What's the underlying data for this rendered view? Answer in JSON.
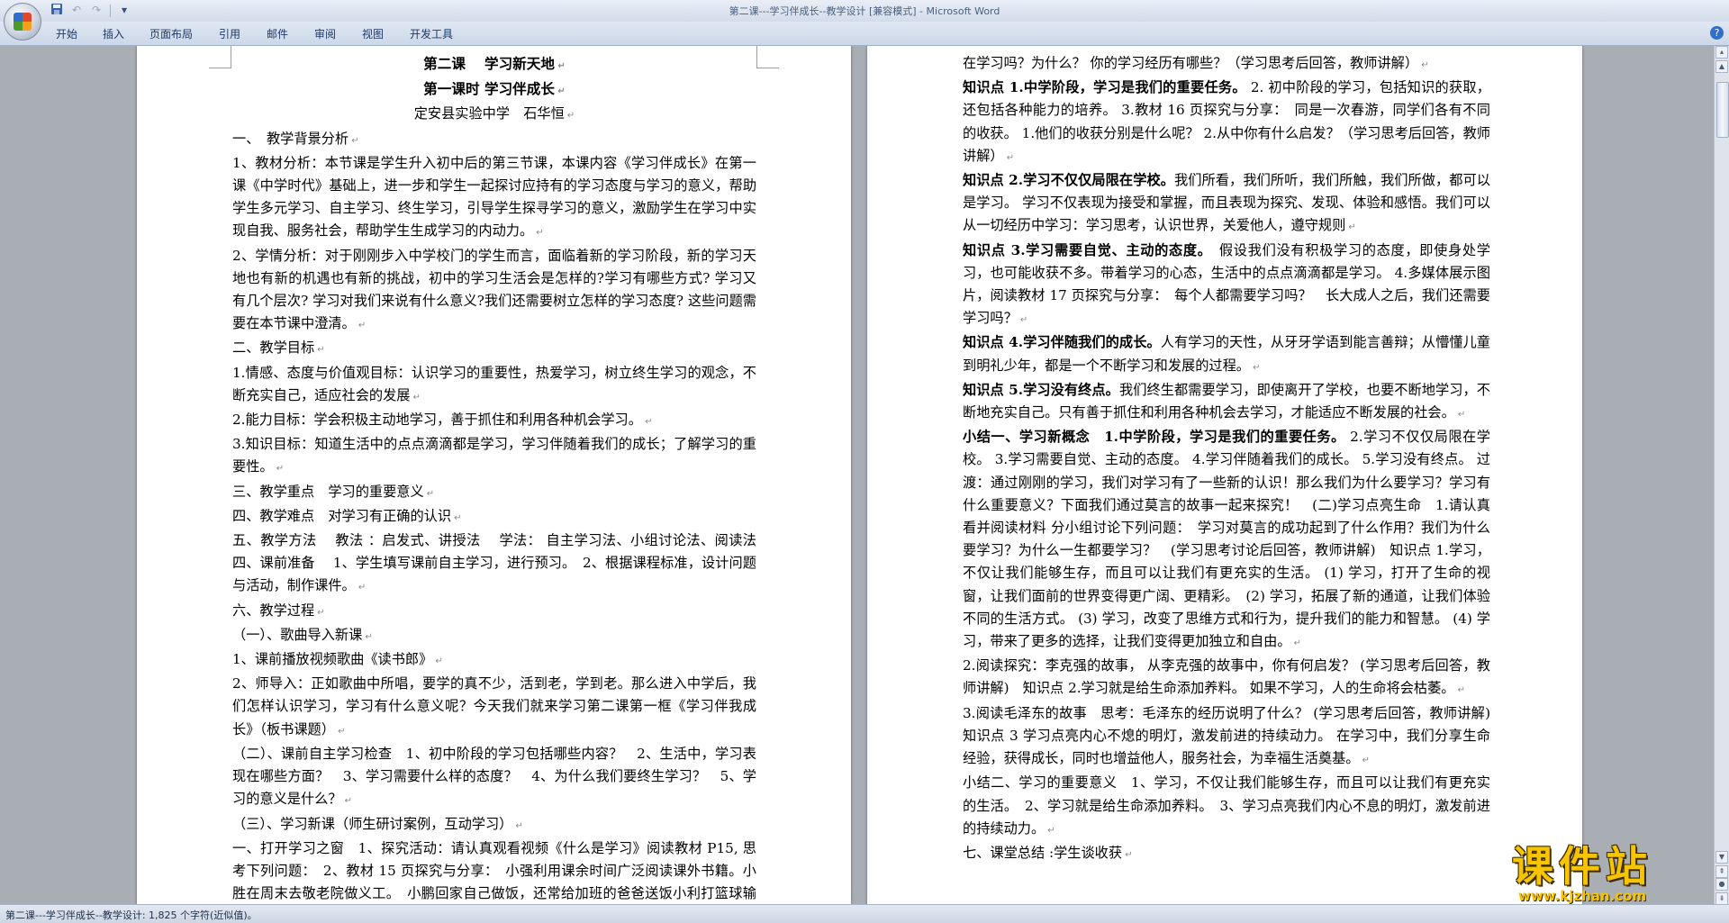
{
  "window": {
    "title": "第二课---学习伴成长--教学设计 [兼容模式] - Microsoft Word"
  },
  "quick_access": {
    "save_icon": "floppy-disk-icon",
    "undo_icon": "undo-icon",
    "redo_icon": "redo-icon",
    "customize_icon": "chevron-down-icon"
  },
  "ribbon": {
    "tabs": [
      "开始",
      "插入",
      "页面布局",
      "引用",
      "邮件",
      "审阅",
      "视图",
      "开发工具"
    ],
    "help_label": "?"
  },
  "page_left": {
    "lines": [
      {
        "text": "第二课　 学习新天地",
        "style": "title"
      },
      {
        "text": "第一课时  学习伴成长",
        "style": "title"
      },
      {
        "text": "定安县实验中学　石华恒",
        "style": "center"
      },
      {
        "text": "一、　教学背景分析",
        "style": ""
      },
      {
        "text": "1、教材分析：本节课是学生升入初中后的第三节课，本课内容《学习伴成长》在第一课《中学时代》基础上，进一步和学生一起探讨应持有的学习态度与学习的意义，帮助学生多元学习、自主学习、终生学习，引导学生探寻学习的意义，激励学生在学习中实现自我、服务社会，帮助学生生成学习的内动力。",
        "style": ""
      },
      {
        "text": "2、学情分析：对于刚刚步入中学校门的学生而言，面临着新的学习阶段，新的学习天地也有新的机遇也有新的挑战，初中的学习生活会是怎样的?学习有哪些方式? 学习又有几个层次? 学习对我们来说有什么意义?我们还需要树立怎样的学习态度? 这些问题需要在本节课中澄清。",
        "style": ""
      },
      {
        "text": "二、教学目标",
        "style": ""
      },
      {
        "text": "1.情感、态度与价值观目标：认识学习的重要性，热爱学习，树立终生学习的观念，不断充实自己，适应社会的发展",
        "style": ""
      },
      {
        "text": "2.能力目标：学会积极主动地学习，善于抓住和利用各种机会学习。",
        "style": ""
      },
      {
        "text": "3.知识目标：知道生活中的点点滴滴都是学习，学习伴随着我们的成长；了解学习的重要性。",
        "style": ""
      },
      {
        "text": "三、教学重点　学习的重要意义",
        "style": ""
      },
      {
        "text": "四、教学难点　对学习有正确的认识",
        "style": ""
      },
      {
        "text": "五、教学方法　 教法 ：启发式、讲授法　 学法： 自主学习法、小组讨论法、阅读法四、课前准备　 1、学生填写课前自主学习，进行预习。　2、根据课程标准，设计问题与活动，制作课件。",
        "style": ""
      },
      {
        "text": "六、教学过程",
        "style": ""
      },
      {
        "text": "（一）、歌曲导入新课",
        "style": ""
      },
      {
        "text": "1、课前播放视频歌曲《读书郎》",
        "style": ""
      },
      {
        "text": "2、师导入：正如歌曲中所唱，要学的真不少，活到老，学到老。那么进入中学后，我们怎样认识学习，学习有什么意义呢？今天我们就来学习第二课第一框《学习伴我成长》（板书课题）",
        "style": ""
      },
      {
        "text": "（二）、课前自主学习检查　1、初中阶段的学习包括哪些内容？　2、生活中，学习表现在哪些方面？　3、学习需要什么样的态度？　4、为什么我们要终生学习？　5、学习的意义是什么？",
        "style": ""
      },
      {
        "text": "（三）、学习新课（师生研讨案例，互动学习）",
        "style": ""
      },
      {
        "text": "一、打开学习之窗　1、探究活动：请认真观看视频《什么是学习》阅读教材 P15, 思考下列问题：　2、教材 15 页探究与分享：　小强利用课余时间广泛阅读课外书籍。小胜在周末去敬老院做义工。　小鹏回家自己做饭，还常给加班的爸爸送饭小利打篮球输了，被同伴喝倒彩，他装作什么都没有发生一样喝同伴一起聊天。。　他们是",
        "style": "lead"
      }
    ]
  },
  "page_right": {
    "lines": [
      {
        "text": "在学习吗？为什么？  你的学习经历有哪些？（学习思考后回答，教师讲解）",
        "style": ""
      },
      {
        "text": "知识点 1.中学阶段，学习是我们的重要任务。 2. 初中阶段的学习，包括知识的获取，还包括各种能力的培养。 3.教材 16 页探究与分享：　同是一次春游，同学们各有不同的收获。 1.他们的收获分别是什么呢？ 2.从中你有什么启发？（学习思考后回答，教师讲解）",
        "style": "lead"
      },
      {
        "text": "知识点 2.学习不仅仅局限在学校。我们所看，我们所听，我们所触，我们所做，都可以是学习。 学习不仅表现为接受和掌握，而且表现为探究、发现、体验和感悟。我们可以从一切经历中学习：学习思考，认识世界，关爱他人，遵守规则",
        "style": "lead"
      },
      {
        "text": "知识点 3.学习需要自觉、主动的态度。　假设我们没有积极学习的态度，即使身处学习，也可能收获不多。带着学习的心态，生活中的点点滴滴都是学习。 4.多媒体展示图片，阅读教材 17 页探究与分享：　每个人都需要学习吗？　长大成人之后，我们还需要学习吗？",
        "style": "lead"
      },
      {
        "text": "知识点 4.学习伴随我们的成长。人有学习的天性，从牙牙学语到能言善辩；从懵懂儿童到明礼少年，都是一个不断学习和发展的过程。",
        "style": "lead"
      },
      {
        "text": "知识点 5.学习没有终点。我们终生都需要学习，即使离开了学校，也要不断地学习，不断地充实自己。只有善于抓住和利用各种机会去学习，才能适应不断发展的社会。",
        "style": "lead"
      },
      {
        "text": "小结一、学习新概念　1.中学阶段，学习是我们的重要任务。 2.学习不仅仅局限在学校。 3.学习需要自觉、主动的态度。 4.学习伴随着我们的成长。 5.学习没有终点。 过渡：通过刚刚的学习，我们对学习有了一些新的认识！那么我们为什么要学习？学习有什么重要意义？下面我们通过莫言的故事一起来探究！　(二)学习点亮生命　1.请认真看并阅读材料 分小组讨论下列问题：　学习对莫言的成功起到了什么作用？我们为什么要学习？为什么一生都要学习？　(学习思考讨论后回答，教师讲解)　知识点 1.学习，不仅让我们能够生存，而且可以让我们有更充实的生活。 (1) 学习，打开了生命的视窗，让我们面前的世界变得更广阔、更精彩。　(2) 学习，拓展了新的通道，让我们体验不同的生活方式。 (3) 学习，改变了思维方式和行为，提升我们的能力和智慧。 (4) 学习，带来了更多的选择，让我们变得更加独立和自由。",
        "style": "lead"
      },
      {
        "text": "2.阅读探究：李克强的故事， 从李克强的故事中，你有何启发？ (学习思考后回答，教师讲解)　知识点 2.学习就是给生命添加养料。 如果不学习，人的生命将会枯萎。",
        "style": ""
      },
      {
        "text": "3.阅读毛泽东的故事　思考：毛泽东的经历说明了什么？ (学习思考后回答，教师讲解)　知识点 3 学习点亮内心不熄的明灯，激发前进的持续动力。 在学习中，我们分享生命经验，获得成长，同时也增益他人，服务社会，为幸福生活奠基。",
        "style": ""
      },
      {
        "text": "小结二、学习的重要意义　1、学习，不仅让我们能够生存，而且可以让我们有更充实的生活。　2、学习就是给生命添加养料。　3、学习点亮我们内心不息的明灯，激发前进的持续动力。",
        "style": "lead"
      },
      {
        "text": "七、课堂总结 :学生谈收获",
        "style": ""
      }
    ]
  },
  "statusbar": {
    "text": "第二课---学习伴成长--教学设计: 1,825 个字符(近似值)。"
  },
  "watermark": {
    "main": "课件站",
    "url": "www.kjzhan.com"
  }
}
